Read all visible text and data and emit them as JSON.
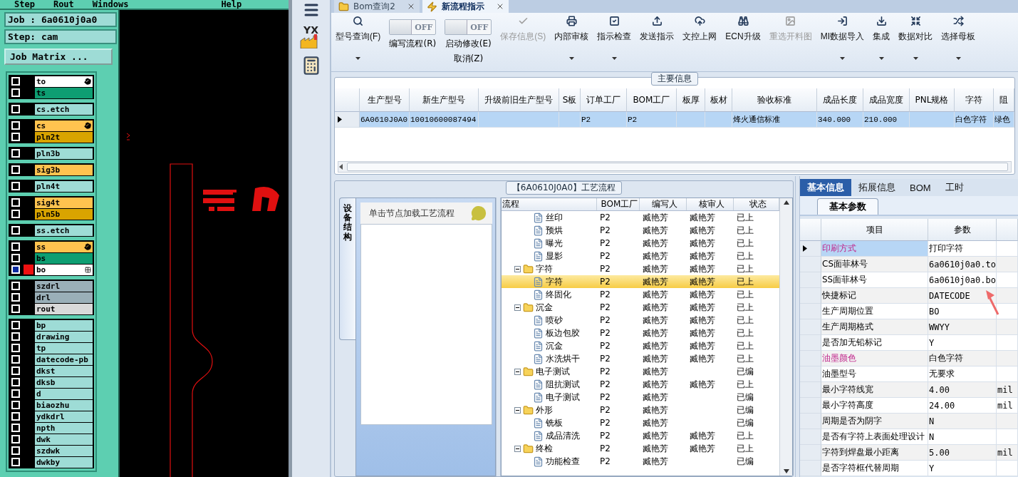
{
  "cam": {
    "menu": [
      "Step",
      "Rout",
      "Windows",
      "Help"
    ],
    "job": "Job : 6a0610j0a0",
    "step": "Step: cam",
    "matrix_button": "Job Matrix ...",
    "layer_groups": [
      {
        "layers": [
          {
            "name": "to",
            "color": "#ffffff",
            "selected": false,
            "kind": "hand"
          },
          {
            "name": "ts",
            "color": "#0e9e72",
            "selected": false,
            "kind": "plain"
          }
        ]
      },
      {
        "layers": [
          {
            "name": "cs.etch",
            "color": "#9edcd6",
            "selected": false
          }
        ]
      },
      {
        "layers": [
          {
            "name": "cs",
            "color": "#ffc34f",
            "selected": false,
            "kind": "hand"
          },
          {
            "name": "pln2t",
            "color": "#d9a400",
            "selected": false,
            "kind": "plain"
          }
        ]
      },
      {
        "layers": [
          {
            "name": "pln3b",
            "color": "#9edcd6",
            "selected": false
          }
        ]
      },
      {
        "layers": [
          {
            "name": "sig3b",
            "color": "#ffc34f",
            "selected": false
          }
        ]
      },
      {
        "layers": [
          {
            "name": "pln4t",
            "color": "#9edcd6",
            "selected": false
          }
        ]
      },
      {
        "layers": [
          {
            "name": "sig4t",
            "color": "#ffc34f",
            "selected": false
          },
          {
            "name": "pln5b",
            "color": "#d9a400",
            "selected": false
          }
        ]
      },
      {
        "layers": [
          {
            "name": "ss.etch",
            "color": "#9edcd6",
            "selected": false
          }
        ]
      },
      {
        "layers": [
          {
            "name": "ss",
            "color": "#ffc34f",
            "selected": false,
            "kind": "hand"
          },
          {
            "name": "bs",
            "color": "#0e9e72",
            "selected": false,
            "kind": "plain"
          },
          {
            "name": "bo",
            "color": "#ffffff",
            "selected": true,
            "kind": "grid"
          }
        ]
      },
      {
        "layers": [
          {
            "name": "szdrl",
            "color": "#9aafb8",
            "selected": false
          },
          {
            "name": "drl",
            "color": "#9aafb8",
            "selected": false
          },
          {
            "name": "rout",
            "color": "#d9d9d9",
            "selected": false
          }
        ]
      },
      {
        "layers": [
          {
            "name": "bp",
            "color": "#9edcd6",
            "selected": false
          },
          {
            "name": "drawing",
            "color": "#9edcd6",
            "selected": false
          },
          {
            "name": "tp",
            "color": "#9edcd6",
            "selected": false
          },
          {
            "name": "datecode-pb",
            "color": "#9edcd6",
            "selected": false
          },
          {
            "name": "dkst",
            "color": "#9edcd6",
            "selected": false
          },
          {
            "name": "dksb",
            "color": "#9edcd6",
            "selected": false
          },
          {
            "name": "d",
            "color": "#9edcd6",
            "selected": false
          },
          {
            "name": "biaozhu",
            "color": "#9edcd6",
            "selected": false
          },
          {
            "name": "ydkdrl",
            "color": "#9edcd6",
            "selected": false
          },
          {
            "name": "npth",
            "color": "#9edcd6",
            "selected": false
          },
          {
            "name": "dwk",
            "color": "#9edcd6",
            "selected": false
          },
          {
            "name": "szdwk",
            "color": "#9edcd6",
            "selected": false
          },
          {
            "name": "dwkby",
            "color": "#9edcd6",
            "selected": false
          }
        ]
      }
    ]
  },
  "nav": {
    "logo_text": "YX"
  },
  "tabs": [
    {
      "label": "Bom查询2",
      "selected": false
    },
    {
      "label": "新流程指示",
      "selected": true
    }
  ],
  "ribbon": [
    {
      "kind": "button",
      "label": "型号查询(F)",
      "dropdown": true,
      "disabled": false
    },
    {
      "kind": "toggle",
      "label": "编写流程(R)",
      "switch_text": "OFF",
      "on": false
    },
    {
      "kind": "toggle",
      "label": "启动修改(E)",
      "sublabel": "取消(Z)",
      "switch_text": "OFF",
      "on": false
    },
    {
      "kind": "button",
      "label": "保存信息(S)",
      "dropdown": false,
      "disabled": true
    },
    {
      "kind": "button",
      "label": "内部审核",
      "dropdown": true,
      "disabled": false
    },
    {
      "kind": "button",
      "label": "指示检查",
      "dropdown": true,
      "disabled": false
    },
    {
      "kind": "button",
      "label": "发送指示",
      "dropdown": false,
      "disabled": false
    },
    {
      "kind": "button",
      "label": "文控上网",
      "dropdown": false,
      "disabled": false
    },
    {
      "kind": "button",
      "label": "ECN升级",
      "dropdown": false,
      "disabled": false
    },
    {
      "kind": "button",
      "label": "重选开料图",
      "dropdown": false,
      "disabled": true
    },
    {
      "kind": "button",
      "label": "MI数据导入",
      "dropdown": true,
      "disabled": false
    },
    {
      "kind": "button",
      "label": "集成",
      "dropdown": true,
      "disabled": false
    },
    {
      "kind": "button",
      "label": "数据对比",
      "dropdown": true,
      "disabled": false
    },
    {
      "kind": "button",
      "label": "选择母板",
      "dropdown": true,
      "disabled": false
    }
  ],
  "main_info": {
    "legend": "主要信息",
    "columns": [
      "生产型号",
      "新生产型号",
      "升级前旧生产型号",
      "S板",
      "订单工厂",
      "BOM工厂",
      "板厚",
      "板材",
      "验收标准",
      "成品长度",
      "成品宽度",
      "PNL规格",
      "字符",
      "阻"
    ],
    "rows": [
      {
        "selected": true,
        "cells": [
          "6A0610J0A0",
          "10010600087494",
          null,
          null,
          "P2",
          "P2",
          null,
          null,
          "烽火通信标准",
          "340.000",
          "210.000",
          null,
          "白色字符",
          "绿色"
        ]
      }
    ]
  },
  "flow": {
    "legend": "【6A0610J0A0】工艺流程",
    "side_tab": "设备结构",
    "hint": "单击节点加载工艺流程",
    "columns": [
      "流程",
      "BOM工厂",
      "编写人",
      "核审人",
      "状态"
    ],
    "nodes": [
      {
        "kind": "step",
        "name": "丝印",
        "factory": "P2",
        "writer": "臧艳芳",
        "reviewer": "臧艳芳",
        "status": "已上",
        "selected": false
      },
      {
        "kind": "step",
        "name": "预烘",
        "factory": "P2",
        "writer": "臧艳芳",
        "reviewer": "臧艳芳",
        "status": "已上",
        "selected": false
      },
      {
        "kind": "step",
        "name": "曝光",
        "factory": "P2",
        "writer": "臧艳芳",
        "reviewer": "臧艳芳",
        "status": "已上",
        "selected": false
      },
      {
        "kind": "step",
        "name": "显影",
        "factory": "P2",
        "writer": "臧艳芳",
        "reviewer": "臧艳芳",
        "status": "已上",
        "selected": false
      },
      {
        "kind": "folder",
        "name": "字符",
        "factory": "P2",
        "writer": "臧艳芳",
        "reviewer": "臧艳芳",
        "status": "已上",
        "selected": false,
        "expanded": true,
        "children": [
          {
            "kind": "step",
            "name": "字符",
            "factory": "P2",
            "writer": "臧艳芳",
            "reviewer": "臧艳芳",
            "status": "已上",
            "selected": true
          },
          {
            "kind": "step",
            "name": "终固化",
            "factory": "P2",
            "writer": "臧艳芳",
            "reviewer": "臧艳芳",
            "status": "已上",
            "selected": false
          }
        ]
      },
      {
        "kind": "folder",
        "name": "沉金",
        "factory": "P2",
        "writer": "臧艳芳",
        "reviewer": "臧艳芳",
        "status": "已上",
        "selected": false,
        "expanded": true,
        "children": [
          {
            "kind": "step",
            "name": "喷砂",
            "factory": "P2",
            "writer": "臧艳芳",
            "reviewer": "臧艳芳",
            "status": "已上",
            "selected": false
          },
          {
            "kind": "step",
            "name": "板边包胶",
            "factory": "P2",
            "writer": "臧艳芳",
            "reviewer": "臧艳芳",
            "status": "已上",
            "selected": false
          },
          {
            "kind": "step",
            "name": "沉金",
            "factory": "P2",
            "writer": "臧艳芳",
            "reviewer": "臧艳芳",
            "status": "已上",
            "selected": false
          },
          {
            "kind": "step",
            "name": "水洗烘干",
            "factory": "P2",
            "writer": "臧艳芳",
            "reviewer": "臧艳芳",
            "status": "已上",
            "selected": false
          }
        ]
      },
      {
        "kind": "folder",
        "name": "电子测试",
        "factory": "P2",
        "writer": "臧艳芳",
        "status": "已编",
        "selected": false,
        "expanded": true,
        "children": [
          {
            "kind": "step",
            "name": "阻抗测试",
            "factory": "P2",
            "writer": "臧艳芳",
            "reviewer": "臧艳芳",
            "status": "已上",
            "selected": false
          },
          {
            "kind": "step",
            "name": "电子测试",
            "factory": "P2",
            "writer": "臧艳芳",
            "status": "已编",
            "selected": false
          }
        ]
      },
      {
        "kind": "folder",
        "name": "外形",
        "factory": "P2",
        "writer": "臧艳芳",
        "status": "已编",
        "selected": false,
        "expanded": true,
        "children": [
          {
            "kind": "step",
            "name": "铣板",
            "factory": "P2",
            "writer": "臧艳芳",
            "status": "已编",
            "selected": false
          },
          {
            "kind": "step",
            "name": "成品清洗",
            "factory": "P2",
            "writer": "臧艳芳",
            "reviewer": "臧艳芳",
            "status": "已上",
            "selected": false
          }
        ]
      },
      {
        "kind": "folder",
        "name": "终检",
        "factory": "P2",
        "writer": "臧艳芳",
        "reviewer": "臧艳芳",
        "status": "已上",
        "selected": false,
        "expanded": true,
        "children": [
          {
            "kind": "step",
            "name": "功能检查",
            "factory": "P2",
            "writer": "臧艳芳",
            "status": "已编",
            "selected": false
          }
        ]
      }
    ]
  },
  "details": {
    "tabs": [
      {
        "label": "基本信息",
        "selected": true
      },
      {
        "label": "拓展信息",
        "selected": false
      },
      {
        "label": "BOM",
        "selected": false
      },
      {
        "label": "工时",
        "selected": false
      }
    ],
    "subtab": "基本参数",
    "columns": [
      "项目",
      "参数"
    ],
    "rows": [
      {
        "item": "印刷方式",
        "value": "打印字符",
        "highlighted": true,
        "selected": true
      },
      {
        "item": "CS面菲林号",
        "value": "6a0610j0a0.to",
        "highlighted": false,
        "selected": false
      },
      {
        "item": "SS面菲林号",
        "value": "6a0610j0a0.bo",
        "highlighted": false,
        "selected": false
      },
      {
        "item": "快捷标记",
        "value": "DATECODE",
        "highlighted": false,
        "selected": false
      },
      {
        "item": "生产周期位置",
        "value": "BO",
        "highlighted": false,
        "selected": false
      },
      {
        "item": "生产周期格式",
        "value": "WWYY",
        "highlighted": false,
        "selected": false
      },
      {
        "item": "是否加无铅标记",
        "value": "Y",
        "highlighted": false,
        "selected": false
      },
      {
        "item": "油墨颜色",
        "value": "白色字符",
        "highlighted": true,
        "selected": false
      },
      {
        "item": "油墨型号",
        "value": "无要求",
        "highlighted": false,
        "selected": false
      },
      {
        "item": "最小字符线宽",
        "value": "4.00",
        "unit": "mil",
        "highlighted": false,
        "selected": false
      },
      {
        "item": "最小字符高度",
        "value": "24.00",
        "unit": "mil",
        "highlighted": false,
        "selected": false
      },
      {
        "item": "周期是否为阴字",
        "value": "N",
        "highlighted": false,
        "selected": false
      },
      {
        "item": "是否有字符上表面处理设计",
        "value": "N",
        "highlighted": false,
        "selected": false
      },
      {
        "item": "字符到焊盘最小距离",
        "value": "5.00",
        "unit": "mil",
        "highlighted": false,
        "selected": false
      },
      {
        "item": "是否字符框代替周期",
        "value": "Y",
        "highlighted": false,
        "selected": false
      }
    ]
  }
}
